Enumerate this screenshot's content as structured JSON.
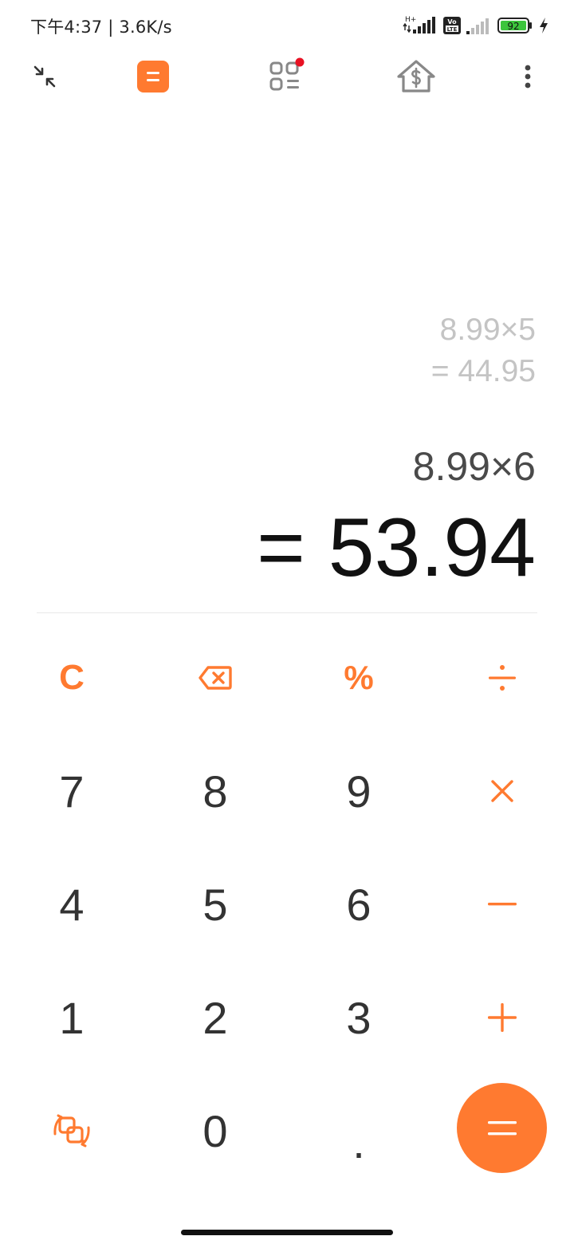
{
  "status_bar": {
    "time_speed": "下午4:37 | 3.6K/s",
    "network_label": "H+",
    "volte_line1": "Vo",
    "volte_line2": "LTE",
    "battery_level": "92"
  },
  "toolbar": {
    "icons": [
      "collapse-icon",
      "calculator-icon",
      "grid-menu-icon",
      "mortgage-icon",
      "more-icon"
    ],
    "notification_dot_color": "#e81123"
  },
  "display": {
    "history_expression": "8.99×5",
    "history_result": "= 44.95",
    "current_expression": "8.99×6",
    "current_result": "= 53.94"
  },
  "keypad": {
    "row1": {
      "clear": "C",
      "percent": "%"
    },
    "digits": {
      "seven": "7",
      "eight": "8",
      "nine": "9",
      "four": "4",
      "five": "5",
      "six": "6",
      "one": "1",
      "two": "2",
      "three": "3",
      "zero": "0",
      "dot": "."
    },
    "icons": [
      "backspace-icon",
      "divide-icon",
      "multiply-icon",
      "minus-icon",
      "plus-icon",
      "convert-icon",
      "equals-icon"
    ]
  },
  "colors": {
    "accent": "#ff7a30",
    "digit_text": "#333333",
    "history_text": "#c4c4c4",
    "result_text": "#111111"
  }
}
